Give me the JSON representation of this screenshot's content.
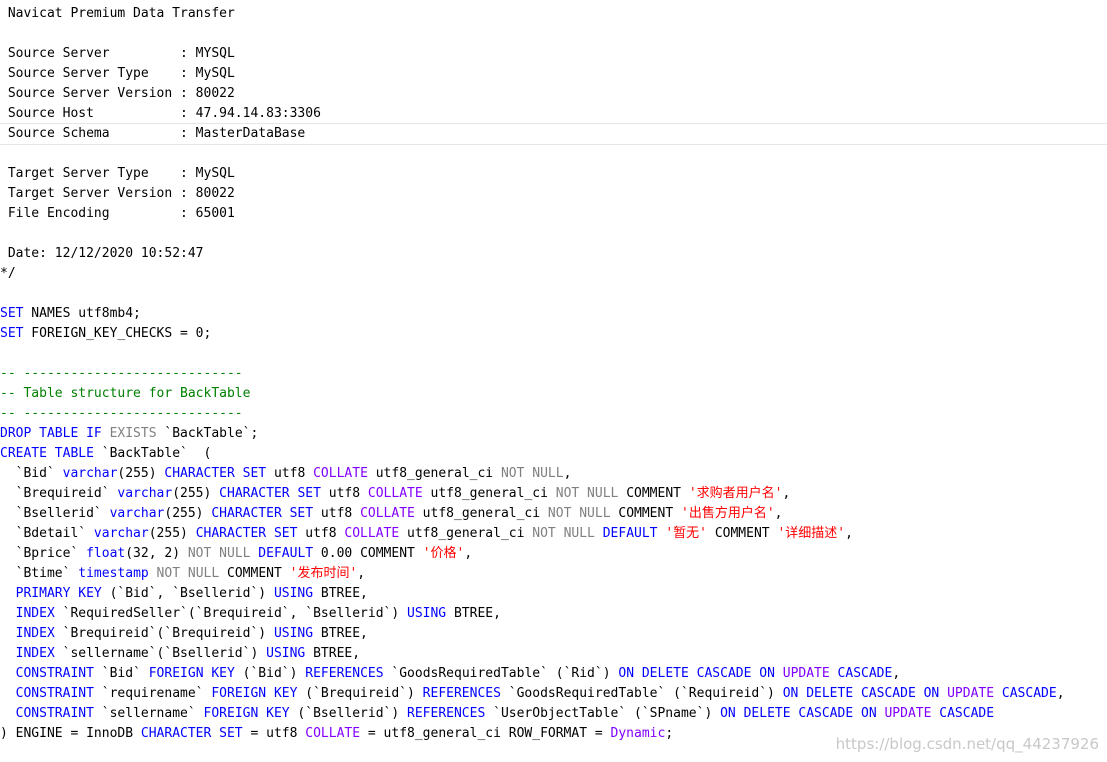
{
  "watermark": "https://blog.csdn.net/qq_44237926",
  "header": [
    {
      "label": " Navicat Premium Data Transfer",
      "value": ""
    },
    {
      "label": "",
      "value": ""
    },
    {
      "label": " Source Server         : ",
      "value": "MYSQL"
    },
    {
      "label": " Source Server Type    : ",
      "value": "MySQL"
    },
    {
      "label": " Source Server Version : ",
      "value": "80022"
    },
    {
      "label": " Source Host           : ",
      "value": "47.94.14.83:3306"
    },
    {
      "label": " Source Schema         : ",
      "value": "MasterDataBase"
    },
    {
      "label": "",
      "value": ""
    },
    {
      "label": " Target Server Type    : ",
      "value": "MySQL"
    },
    {
      "label": " Target Server Version : ",
      "value": "80022"
    },
    {
      "label": " File Encoding         : ",
      "value": "65001"
    },
    {
      "label": "",
      "value": ""
    },
    {
      "label": " Date: ",
      "value": "12/12/2020 10:52:47"
    },
    {
      "label": "*/",
      "value": ""
    }
  ],
  "code": [
    [],
    [
      [
        "kw",
        "SET"
      ],
      [
        "t",
        " NAMES utf8mb4;"
      ]
    ],
    [
      [
        "kw",
        "SET"
      ],
      [
        "t",
        " FOREIGN_KEY_CHECKS = 0;"
      ]
    ],
    [],
    [
      [
        "cmt",
        "-- ----------------------------"
      ]
    ],
    [
      [
        "cmt",
        "-- Table structure for BackTable"
      ]
    ],
    [
      [
        "cmt",
        "-- ----------------------------"
      ]
    ],
    [
      [
        "kw",
        "DROP TABLE IF"
      ],
      [
        "gr",
        " EXISTS"
      ],
      [
        "t",
        " `BackTable`;"
      ]
    ],
    [
      [
        "kw",
        "CREATE TABLE"
      ],
      [
        "t",
        " `BackTable`  ("
      ]
    ],
    [
      [
        "t",
        "  `Bid` "
      ],
      [
        "kw",
        "varchar"
      ],
      [
        "t",
        "(255) "
      ],
      [
        "kw",
        "CHARACTER SET"
      ],
      [
        "t",
        " utf8 "
      ],
      [
        "fn",
        "COLLATE"
      ],
      [
        "t",
        " utf8_general_ci "
      ],
      [
        "gr",
        "NOT NULL"
      ],
      [
        "t",
        ","
      ]
    ],
    [
      [
        "t",
        "  `Brequireid` "
      ],
      [
        "kw",
        "varchar"
      ],
      [
        "t",
        "(255) "
      ],
      [
        "kw",
        "CHARACTER SET"
      ],
      [
        "t",
        " utf8 "
      ],
      [
        "fn",
        "COLLATE"
      ],
      [
        "t",
        " utf8_general_ci "
      ],
      [
        "gr",
        "NOT NULL"
      ],
      [
        "t",
        " COMMENT "
      ],
      [
        "str",
        "'求购者用户名'"
      ],
      [
        "t",
        ","
      ]
    ],
    [
      [
        "t",
        "  `Bsellerid` "
      ],
      [
        "kw",
        "varchar"
      ],
      [
        "t",
        "(255) "
      ],
      [
        "kw",
        "CHARACTER SET"
      ],
      [
        "t",
        " utf8 "
      ],
      [
        "fn",
        "COLLATE"
      ],
      [
        "t",
        " utf8_general_ci "
      ],
      [
        "gr",
        "NOT NULL"
      ],
      [
        "t",
        " COMMENT "
      ],
      [
        "str",
        "'出售方用户名'"
      ],
      [
        "t",
        ","
      ]
    ],
    [
      [
        "t",
        "  `Bdetail` "
      ],
      [
        "kw",
        "varchar"
      ],
      [
        "t",
        "(255) "
      ],
      [
        "kw",
        "CHARACTER SET"
      ],
      [
        "t",
        " utf8 "
      ],
      [
        "fn",
        "COLLATE"
      ],
      [
        "t",
        " utf8_general_ci "
      ],
      [
        "gr",
        "NOT NULL"
      ],
      [
        "kw",
        " DEFAULT "
      ],
      [
        "str",
        "'暂无'"
      ],
      [
        "t",
        " COMMENT "
      ],
      [
        "str",
        "'详细描述'"
      ],
      [
        "t",
        ","
      ]
    ],
    [
      [
        "t",
        "  `Bprice` "
      ],
      [
        "kw",
        "float"
      ],
      [
        "t",
        "(32, 2) "
      ],
      [
        "gr",
        "NOT NULL"
      ],
      [
        "kw",
        " DEFAULT"
      ],
      [
        "t",
        " 0.00 COMMENT "
      ],
      [
        "str",
        "'价格'"
      ],
      [
        "t",
        ","
      ]
    ],
    [
      [
        "t",
        "  `Btime` "
      ],
      [
        "kw",
        "timestamp"
      ],
      [
        "gr",
        " NOT NULL"
      ],
      [
        "t",
        " COMMENT "
      ],
      [
        "str",
        "'发布时间'"
      ],
      [
        "t",
        ","
      ]
    ],
    [
      [
        "t",
        "  "
      ],
      [
        "kw",
        "PRIMARY KEY"
      ],
      [
        "t",
        " (`Bid`, `Bsellerid`) "
      ],
      [
        "kw",
        "USING"
      ],
      [
        "t",
        " BTREE,"
      ]
    ],
    [
      [
        "t",
        "  "
      ],
      [
        "kw",
        "INDEX"
      ],
      [
        "t",
        " `RequiredSeller`(`Brequireid`, `Bsellerid`) "
      ],
      [
        "kw",
        "USING"
      ],
      [
        "t",
        " BTREE,"
      ]
    ],
    [
      [
        "t",
        "  "
      ],
      [
        "kw",
        "INDEX"
      ],
      [
        "t",
        " `Brequireid`(`Brequireid`) "
      ],
      [
        "kw",
        "USING"
      ],
      [
        "t",
        " BTREE,"
      ]
    ],
    [
      [
        "t",
        "  "
      ],
      [
        "kw",
        "INDEX"
      ],
      [
        "t",
        " `sellername`(`Bsellerid`) "
      ],
      [
        "kw",
        "USING"
      ],
      [
        "t",
        " BTREE,"
      ]
    ],
    [
      [
        "t",
        "  "
      ],
      [
        "kw",
        "CONSTRAINT"
      ],
      [
        "t",
        " `Bid` "
      ],
      [
        "kw",
        "FOREIGN KEY"
      ],
      [
        "t",
        " (`Bid`) "
      ],
      [
        "kw",
        "REFERENCES"
      ],
      [
        "t",
        " `GoodsRequiredTable` (`Rid`) "
      ],
      [
        "kw",
        "ON DELETE CASCADE ON"
      ],
      [
        "fn",
        " UPDATE"
      ],
      [
        "kw",
        " CASCADE"
      ],
      [
        "t",
        ","
      ]
    ],
    [
      [
        "t",
        "  "
      ],
      [
        "kw",
        "CONSTRAINT"
      ],
      [
        "t",
        " `requirename` "
      ],
      [
        "kw",
        "FOREIGN KEY"
      ],
      [
        "t",
        " (`Brequireid`) "
      ],
      [
        "kw",
        "REFERENCES"
      ],
      [
        "t",
        " `GoodsRequiredTable` (`Requireid`) "
      ],
      [
        "kw",
        "ON DELETE CASCADE ON"
      ],
      [
        "fn",
        " UPDATE"
      ],
      [
        "kw",
        " CASCADE"
      ],
      [
        "t",
        ","
      ]
    ],
    [
      [
        "t",
        "  "
      ],
      [
        "kw",
        "CONSTRAINT"
      ],
      [
        "t",
        " `sellername` "
      ],
      [
        "kw",
        "FOREIGN KEY"
      ],
      [
        "t",
        " (`Bsellerid`) "
      ],
      [
        "kw",
        "REFERENCES"
      ],
      [
        "t",
        " `UserObjectTable` (`SPname`) "
      ],
      [
        "kw",
        "ON DELETE CASCADE ON"
      ],
      [
        "fn",
        " UPDATE"
      ],
      [
        "kw",
        " CASCADE"
      ]
    ],
    [
      [
        "t",
        ") ENGINE = InnoDB "
      ],
      [
        "kw",
        "CHARACTER SET"
      ],
      [
        "t",
        " = utf8 "
      ],
      [
        "fn",
        "COLLATE"
      ],
      [
        "t",
        " = utf8_general_ci ROW_FORMAT = "
      ],
      [
        "fn",
        "Dynamic"
      ],
      [
        "t",
        ";"
      ]
    ]
  ]
}
